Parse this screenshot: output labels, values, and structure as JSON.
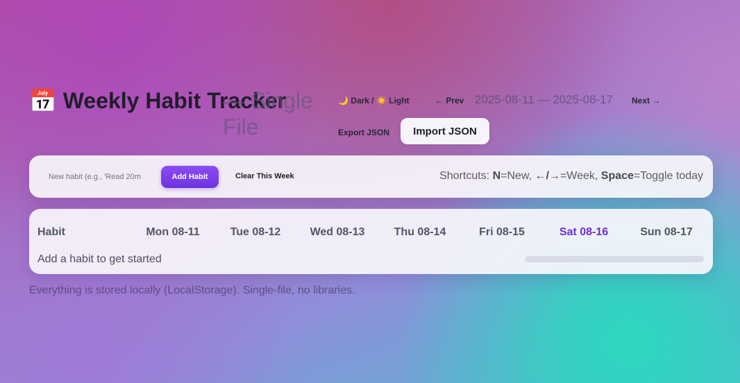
{
  "header": {
    "calendar_icon": "📅",
    "title": "Weekly Habit Tracker",
    "subtitle": "— Single File"
  },
  "controls": {
    "theme_label": "🌙 Dark / ☀️ Light",
    "prev_label": "← Prev",
    "range": "2025-08-11 — 2025-08-17",
    "next_label": "Next →",
    "export_label": "Export JSON",
    "import_label": "Import JSON"
  },
  "toolbar": {
    "input_placeholder": "New habit (e.g., 'Read 20m",
    "add_label": "Add Habit",
    "clear_label": "Clear This Week",
    "shortcuts_prefix": "Shortcuts: ",
    "shortcut_new_key": "N",
    "shortcut_new_text": "=New, ",
    "shortcut_week_key": "←/→",
    "shortcut_week_text": "=Week, ",
    "shortcut_toggle_key": "Space",
    "shortcut_toggle_text": "=Toggle today"
  },
  "grid": {
    "habit_header": "Habit",
    "days": [
      "Mon 08-11",
      "Tue 08-12",
      "Wed 08-13",
      "Thu 08-14",
      "Fri 08-15",
      "Sat 08-16",
      "Sun 08-17"
    ],
    "today_index": 5,
    "empty_text": "Add a habit to get started"
  },
  "footer": {
    "note": "Everything is stored locally (LocalStorage). Single-file, no libraries."
  },
  "colors": {
    "accent": "#7b3fe8",
    "today_text": "#6a2fd6"
  }
}
